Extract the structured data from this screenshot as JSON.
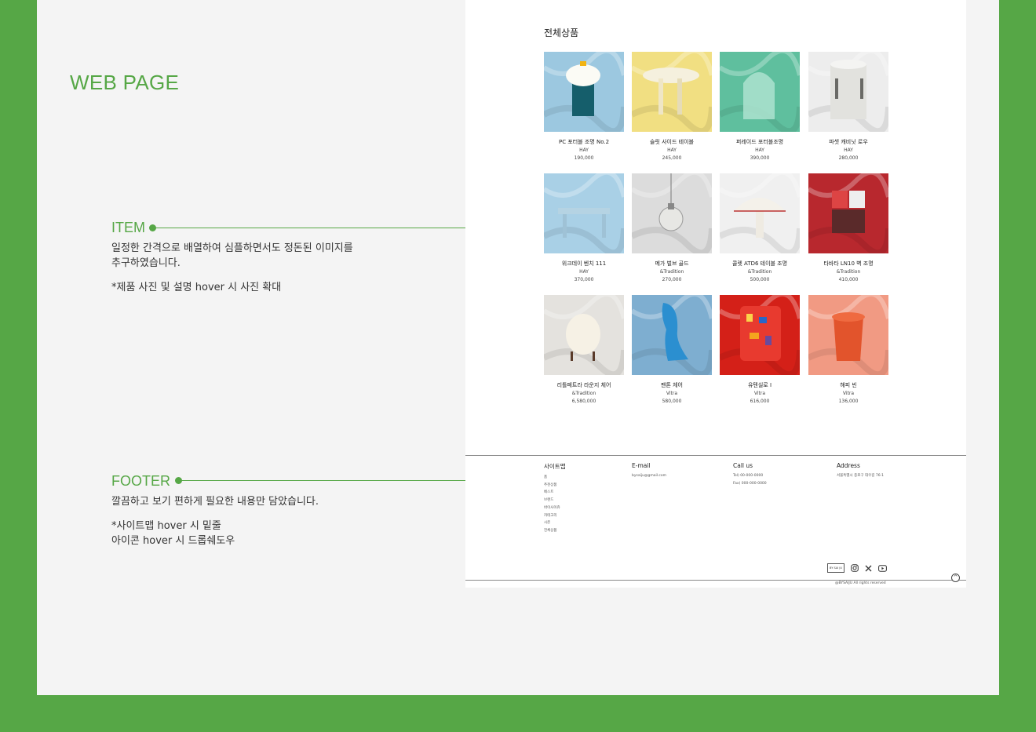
{
  "heading": "WEB PAGE",
  "item_section": {
    "label": "ITEM",
    "desc": "일정한 간격으로 배열하여 심플하면서도 정돈된 이미지를\n추구하였습니다.",
    "note": "*제품 사진 및 설명 hover 시 사진 확대"
  },
  "footer_section": {
    "label": "FOOTER",
    "desc": "깔끔하고 보기 편하게 필요한 내용만 담았습니다.",
    "note": "*사이트맵 hover 시 밑줄\n  아이콘 hover 시 드롭쉐도우"
  },
  "page": {
    "title": "전체상품",
    "products": [
      {
        "name": "PC 포터블 조명 No.2",
        "brand": "HAY",
        "price": "190,000",
        "bg": "#9cc8e0",
        "obj": "lamp-pc"
      },
      {
        "name": "슬릿 사이드 테이블",
        "brand": "HAY",
        "price": "245,000",
        "bg": "#f1df82",
        "obj": "table"
      },
      {
        "name": "퍼레이드 포터블조명",
        "brand": "HAY",
        "price": "390,000",
        "bg": "#5fbf9e",
        "obj": "arch"
      },
      {
        "name": "파셋 캐비닛 로우",
        "brand": "HAY",
        "price": "280,000",
        "bg": "#ededed",
        "obj": "cabinet"
      },
      {
        "name": "위크데이 벤치 111",
        "brand": "HAY",
        "price": "370,000",
        "bg": "#a9d0e6",
        "obj": "bench"
      },
      {
        "name": "메가 벌브 골드",
        "brand": "&Tradition",
        "price": "270,000",
        "bg": "#dcdcdc",
        "obj": "bulb"
      },
      {
        "name": "콜렛 ATD6 테이블 조명",
        "brand": "&Tradition",
        "price": "500,000",
        "bg": "#f0f0f0",
        "obj": "mushroom"
      },
      {
        "name": "타바타 LN10 벽 조명",
        "brand": "&Tradition",
        "price": "410,000",
        "bg": "#b8282e",
        "obj": "wall"
      },
      {
        "name": "리틀페트라 라운지 체어",
        "brand": "&Tradition",
        "price": "6,580,000",
        "bg": "#e4e2de",
        "obj": "chair"
      },
      {
        "name": "팬톤 체어",
        "brand": "Vitra",
        "price": "580,000",
        "bg": "#7eaed0",
        "obj": "panton"
      },
      {
        "name": "유텐실로 I",
        "brand": "Vitra",
        "price": "616,000",
        "bg": "#d42018",
        "obj": "uten"
      },
      {
        "name": "해피 빈",
        "brand": "Vitra",
        "price": "136,000",
        "bg": "#f19a83",
        "obj": "bin"
      }
    ],
    "footer": {
      "sitemap": {
        "title": "사이트맵",
        "items": [
          "홈",
          "추천상품",
          "베스트",
          "브랜드",
          "바이사이쥬",
          "카테고리",
          "시즌",
          "전체상품"
        ]
      },
      "email": {
        "title": "E-mail",
        "value": "bysaiju@gmail.com"
      },
      "call": {
        "title": "Call us",
        "tel": "Tel) 00-000-0000",
        "fax": "Fax) 000-000-0000"
      },
      "address": {
        "title": "Address",
        "value": "서울특별시 종로구 대우길 76-1"
      },
      "logo_text": "BY SAI JU",
      "copyright": "@BYSAIJU All rights reserved"
    }
  }
}
